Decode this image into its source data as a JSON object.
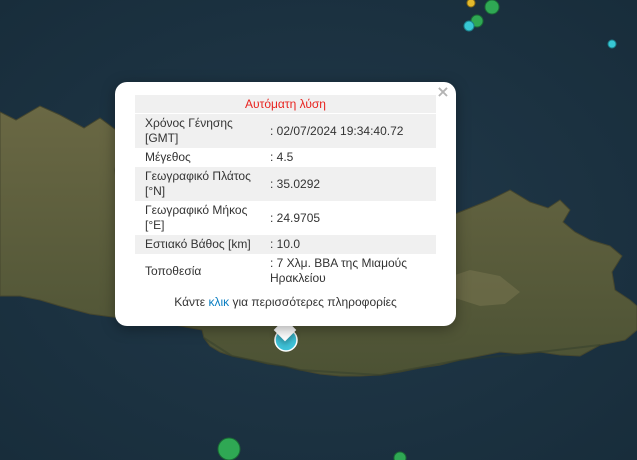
{
  "popup": {
    "title": "Αυτόματη λύση",
    "close_glyph": "×",
    "rows": [
      {
        "label": "Χρόνος Γένησης [GMT]",
        "value": ": 02/07/2024 19:34:40.72"
      },
      {
        "label": "Μέγεθος",
        "value": ": 4.5"
      },
      {
        "label": "Γεωγραφικό Πλάτος [°N]",
        "value": ": 35.0292"
      },
      {
        "label": "Γεωγραφικό Μήκος [°E]",
        "value": ": 24.9705"
      },
      {
        "label": "Εστιακό Βάθος [km]",
        "value": ": 10.0"
      },
      {
        "label": "Τοποθεσία",
        "value": ": 7 Χλμ. ΒΒΑ της Μιαμούς Ηρακλείου"
      }
    ],
    "footer_prefix": "Κάντε",
    "footer_link": "κλικ",
    "footer_suffix": "για περισσότερες πληροφορίες"
  },
  "colors": {
    "sea": "#1d3544",
    "land": "#5b5a3c",
    "title_red": "#e8231f",
    "link_blue": "#0a7ec2",
    "selected_marker": "#3fc3d9",
    "marker_green": "#2fa854",
    "marker_yellow": "#e2b92c",
    "marker_cyan": "#37c7d4"
  }
}
